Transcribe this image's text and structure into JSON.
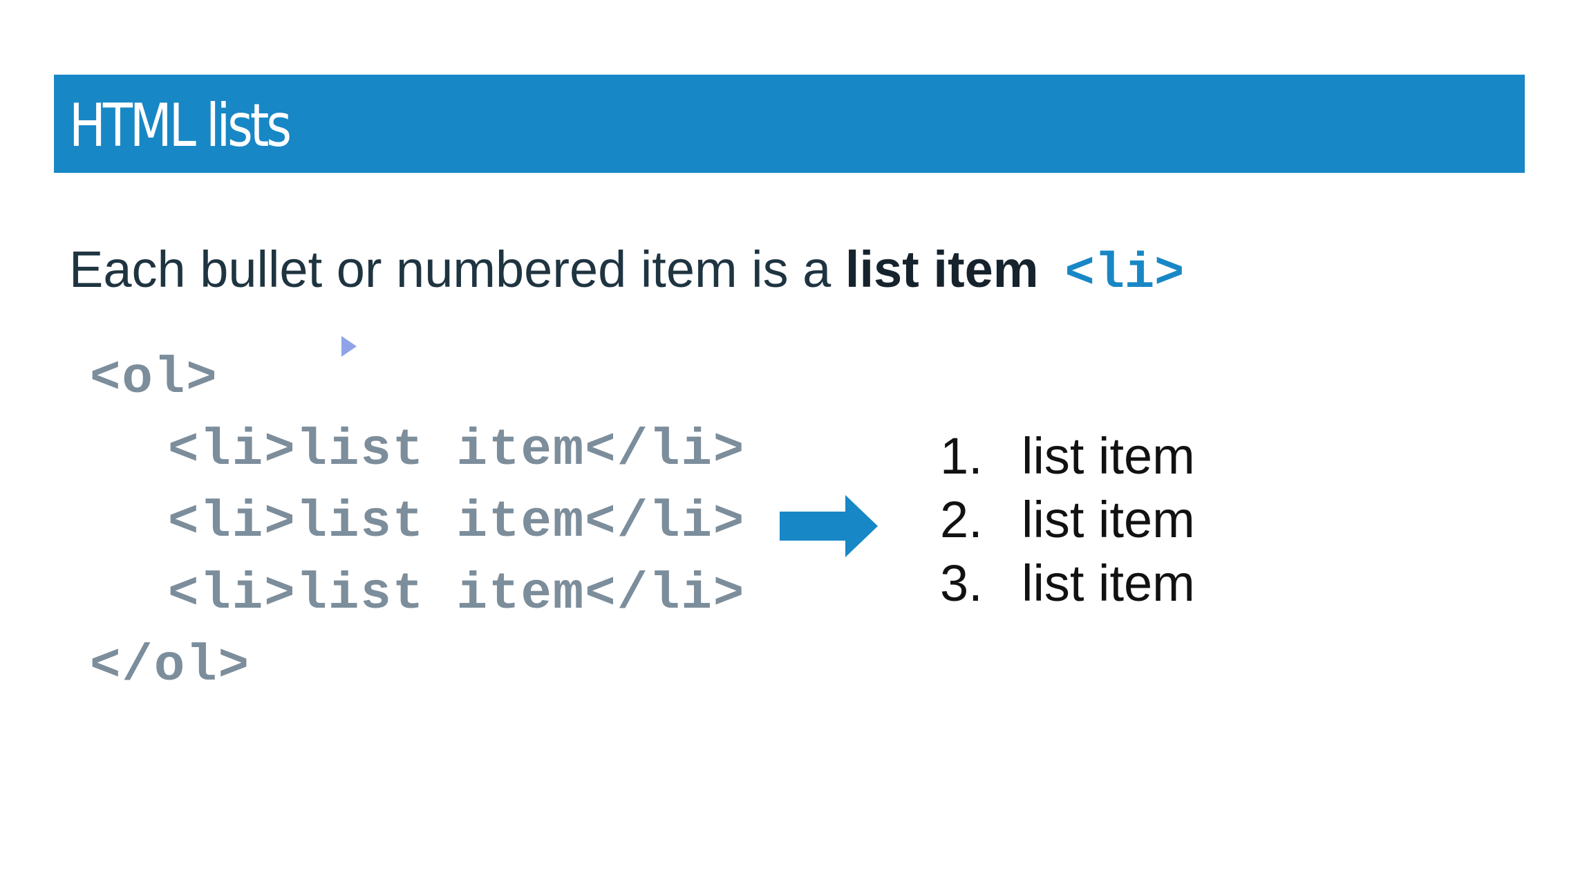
{
  "slide": {
    "title": "HTML lists",
    "subtitle_plain": "Each bullet or numbered item is a ",
    "subtitle_strong": "list item",
    "subtitle_tag": "<li>"
  },
  "code": {
    "lines": [
      "<ol>",
      "<li>list item</li>",
      "<li>list item</li>",
      "<li>list item</li>",
      "</ol>"
    ]
  },
  "rendered_list": {
    "items": [
      {
        "number": "1.",
        "text": "list item"
      },
      {
        "number": "2.",
        "text": "list item"
      },
      {
        "number": "3.",
        "text": "list item"
      }
    ]
  },
  "icons": {
    "arrow": "right-arrow-icon",
    "cursor": "pointer-cursor-icon"
  },
  "colors": {
    "accent": "#1887c6",
    "code_text": "#7c8d9b",
    "body_text": "#1f3441"
  }
}
